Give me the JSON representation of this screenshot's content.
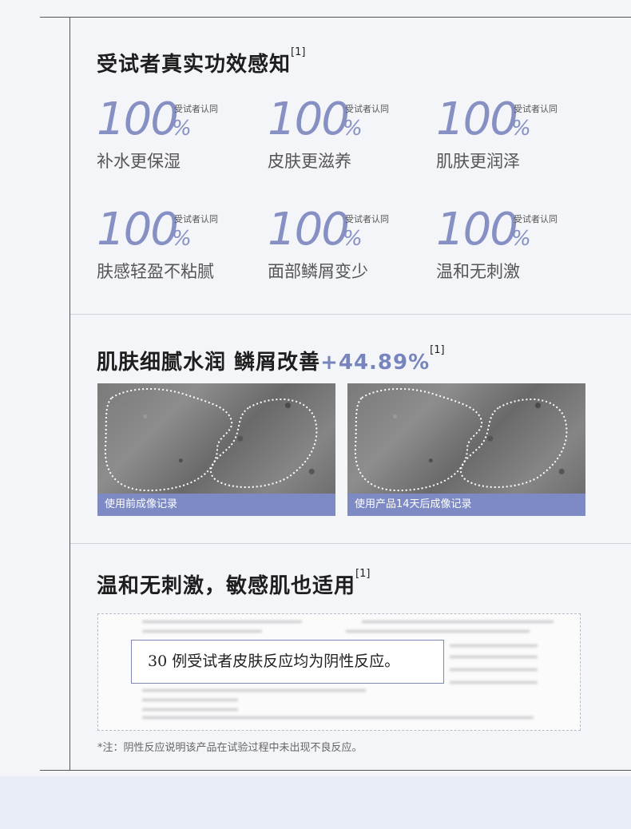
{
  "section1": {
    "title": "受试者真实功效感知",
    "ref": "[1]",
    "stats": [
      {
        "value": "100",
        "unit": "%",
        "tag": "受试者认同",
        "label": "补水更保湿"
      },
      {
        "value": "100",
        "unit": "%",
        "tag": "受试者认同",
        "label": "皮肤更滋养"
      },
      {
        "value": "100",
        "unit": "%",
        "tag": "受试者认同",
        "label": "肌肤更润泽"
      },
      {
        "value": "100",
        "unit": "%",
        "tag": "受试者认同",
        "label": "肤感轻盈不粘腻"
      },
      {
        "value": "100",
        "unit": "%",
        "tag": "受试者认同",
        "label": "面部鳞屑变少"
      },
      {
        "value": "100",
        "unit": "%",
        "tag": "受试者认同",
        "label": "温和无刺激"
      }
    ]
  },
  "section2": {
    "title": "肌肤细腻水润 鳞屑改善",
    "highlight": "+44.89%",
    "ref": "[1]",
    "photos": [
      {
        "caption": "使用前成像记录"
      },
      {
        "caption": "使用产品14天后成像记录"
      }
    ]
  },
  "section3": {
    "title": "温和无刺激，敏感肌也适用",
    "ref": "[1]",
    "callout": "30 例受试者皮肤反应均为阴性反应。",
    "note": "*注：阴性反应说明该产品在试验过程中未出现不良反应。"
  },
  "colors": {
    "accent": "#8690c3",
    "caption_bg": "#7e8ac4"
  }
}
